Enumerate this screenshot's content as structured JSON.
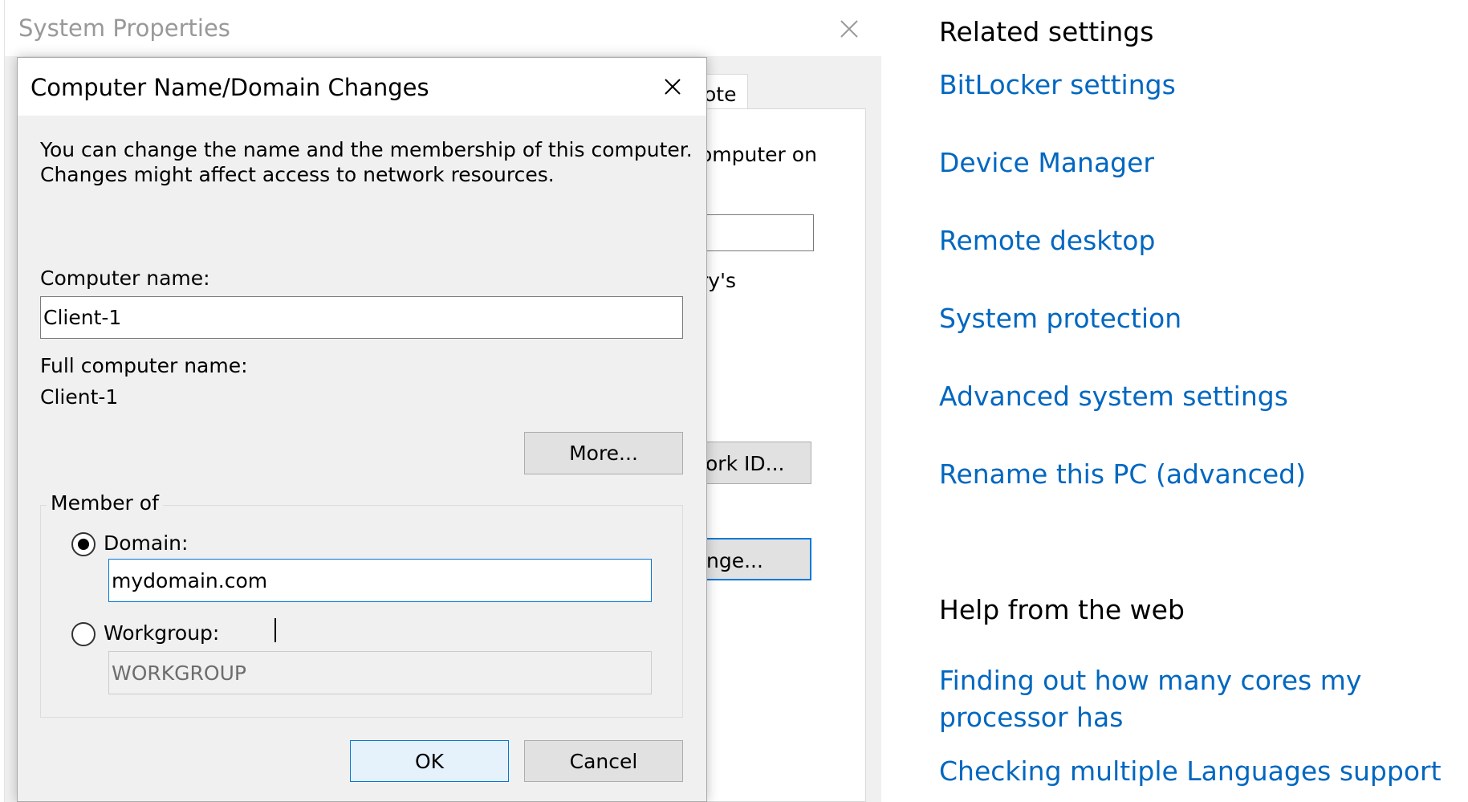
{
  "system_properties": {
    "title": "System Properties",
    "partial_tab": "ote",
    "partial_text_1": "omputer on",
    "partial_text_2": "ry's",
    "partial_button_network_id": "ork ID...",
    "partial_button_change": "nge..."
  },
  "dialog": {
    "title": "Computer Name/Domain Changes",
    "intro_line_1": "You can change the name and the membership of this computer.",
    "intro_line_2": "Changes might affect access to network resources.",
    "computer_name_label": "Computer name:",
    "computer_name_value": "Client-1",
    "full_name_label": "Full computer name:",
    "full_name_value": "Client-1",
    "more_button": "More...",
    "member_of_label": "Member of",
    "domain_label": "Domain:",
    "domain_value": "mydomain.com",
    "workgroup_label": "Workgroup:",
    "workgroup_value": "WORKGROUP",
    "ok_button": "OK",
    "cancel_button": "Cancel",
    "selected_membership": "domain"
  },
  "related_settings": {
    "heading": "Related settings",
    "links": [
      "BitLocker settings",
      "Device Manager",
      "Remote desktop",
      "System protection",
      "Advanced system settings",
      "Rename this PC (advanced)"
    ]
  },
  "help_from_web": {
    "heading": "Help from the web",
    "links": [
      "Finding out how many cores my",
      "processor has",
      "Checking multiple Languages support"
    ]
  },
  "colors": {
    "link": "#0067c0",
    "accent": "#0078d7",
    "dialog_bg": "#f0f0f0"
  }
}
